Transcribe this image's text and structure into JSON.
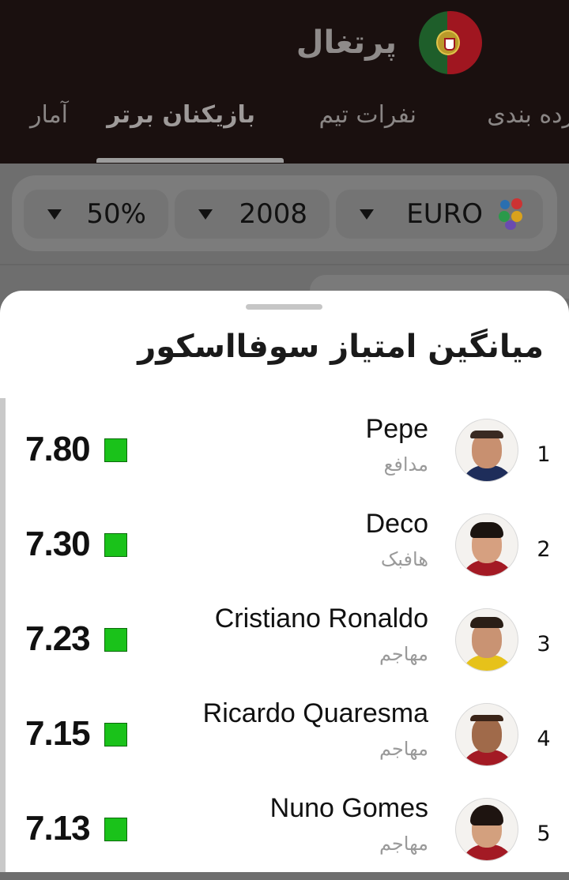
{
  "header": {
    "team_name": "پرتغال",
    "flag_icon": "portugal-flag-icon",
    "tabs": [
      {
        "label": "رده بندی"
      },
      {
        "label": "نفرات تیم"
      },
      {
        "label": "بازیکنان برتر"
      },
      {
        "label": "آمار"
      }
    ],
    "active_tab": 2
  },
  "filters": {
    "competition": "EURO",
    "season": "2008",
    "threshold": "50%"
  },
  "sheet": {
    "title": "میانگین امتیاز سوفااسکور",
    "rating_color": "#1ac21a",
    "players": [
      {
        "rank": "1",
        "name": "Pepe",
        "position": "مدافع",
        "rating": "7.80"
      },
      {
        "rank": "2",
        "name": "Deco",
        "position": "هافبک",
        "rating": "7.30"
      },
      {
        "rank": "3",
        "name": "Cristiano Ronaldo",
        "position": "مهاجم",
        "rating": "7.23"
      },
      {
        "rank": "4",
        "name": "Ricardo Quaresma",
        "position": "مهاجم",
        "rating": "7.15"
      },
      {
        "rank": "5",
        "name": "Nuno Gomes",
        "position": "مهاجم",
        "rating": "7.13"
      }
    ]
  }
}
